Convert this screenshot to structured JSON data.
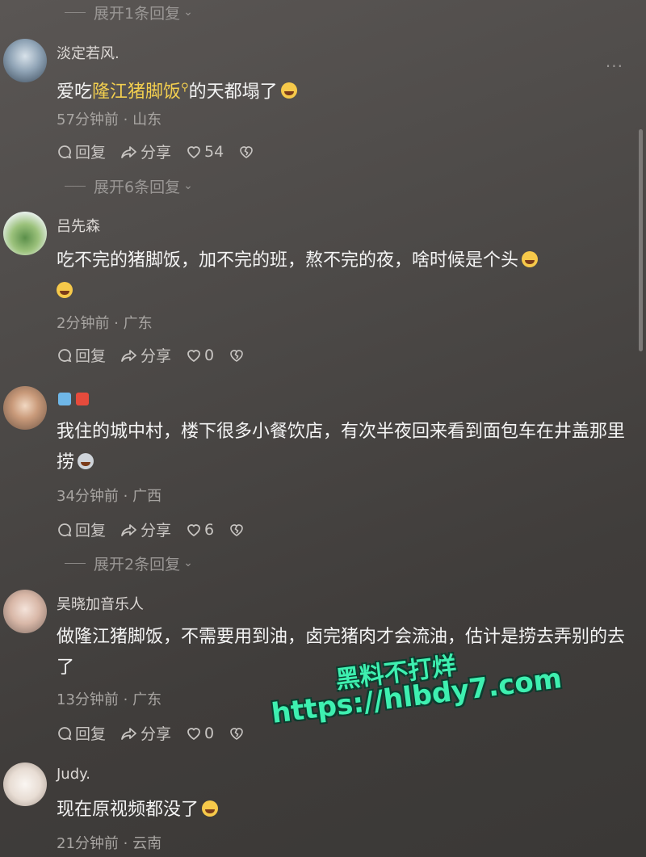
{
  "expand_top": "展开1条回复",
  "more_icon": "···",
  "comments": [
    {
      "name": "淡定若风.",
      "text_pre": "爱吃",
      "text_highlight": "隆江猪脚饭",
      "text_post": "的天都塌了",
      "meta": "57分钟前 · 山东",
      "reply": "回复",
      "share": "分享",
      "likes": "54"
    },
    {
      "expand": "展开6条回复",
      "name": "吕先森",
      "text": "吃不完的猪脚饭，加不完的班，熬不完的夜，啥时候是个头",
      "meta": "2分钟前 · 广东",
      "reply": "回复",
      "share": "分享",
      "likes": "0"
    },
    {
      "name": "",
      "text": "我住的城中村，楼下很多小餐饮店，有次半夜回来看到面包车在井盖那里捞",
      "meta": "34分钟前 · 广西",
      "reply": "回复",
      "share": "分享",
      "likes": "6"
    },
    {
      "expand": "展开2条回复",
      "name": "吴晓加音乐人",
      "text": "做隆江猪脚饭，不需要用到油，卤完猪肉才会流油，估计是捞去弄别的去了",
      "meta": "13分钟前 · 广东",
      "reply": "回复",
      "share": "分享",
      "likes": "0"
    },
    {
      "name": "Judy.",
      "text": "现在原视频都没了",
      "meta": "21分钟前 · 云南"
    }
  ],
  "watermark": {
    "line1": "黑料不打烊",
    "line2": "https://hlbdy7.com"
  },
  "colors": {
    "highlight": "#f3cf4f",
    "watermark": "#3ef0b0"
  }
}
